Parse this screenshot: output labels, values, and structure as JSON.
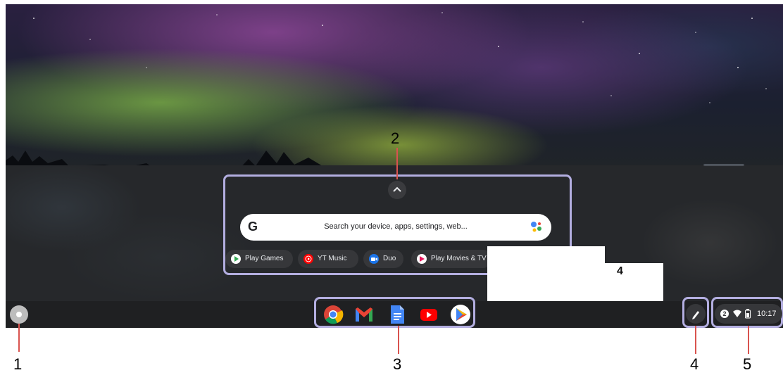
{
  "callouts": {
    "c1": "1",
    "c2": "2",
    "c3": "3",
    "c4": "4",
    "c4b": "4",
    "c5": "5"
  },
  "search": {
    "placeholder": "Search your device, apps, settings, web...",
    "google_letter": "G"
  },
  "suggested_apps": [
    {
      "label": "Play Games",
      "icon": "play-games-icon",
      "color": "#34a853"
    },
    {
      "label": "YT Music",
      "icon": "yt-music-icon",
      "color": "#ff0000"
    },
    {
      "label": "Duo",
      "icon": "duo-icon",
      "color": "#1a73e8"
    },
    {
      "label": "Play Movies & TV",
      "icon": "play-movies-icon",
      "color": "#e8175d"
    }
  ],
  "shelf_apps": [
    {
      "name": "chrome",
      "icon": "chrome-icon"
    },
    {
      "name": "gmail",
      "icon": "gmail-icon"
    },
    {
      "name": "docs",
      "icon": "docs-icon"
    },
    {
      "name": "youtube",
      "icon": "youtube-icon"
    },
    {
      "name": "play-store",
      "icon": "play-store-icon"
    }
  ],
  "status_tray": {
    "notification_count": "2",
    "time": "10:17"
  },
  "colors": {
    "highlight": "#b3aee0",
    "callout_line": "#d9534f",
    "shelf": "#1f2022"
  }
}
